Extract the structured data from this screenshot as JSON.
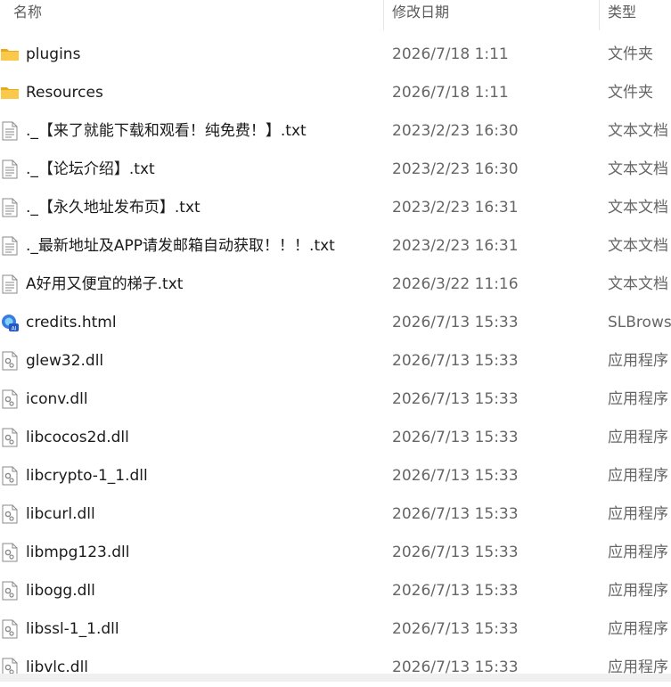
{
  "header": {
    "name": "名称",
    "date": "修改日期",
    "type": "类型"
  },
  "files": [
    {
      "icon": "folder-icon",
      "name": "plugins",
      "date": "2026/7/18 1:11",
      "type": "文件夹"
    },
    {
      "icon": "folder-icon",
      "name": "Resources",
      "date": "2026/7/18 1:11",
      "type": "文件夹"
    },
    {
      "icon": "text-file-icon",
      "name": "._【来了就能下载和观看！纯免费！】.txt",
      "date": "2023/2/23 16:30",
      "type": "文本文档"
    },
    {
      "icon": "text-file-icon",
      "name": "._【论坛介绍】.txt",
      "date": "2023/2/23 16:30",
      "type": "文本文档"
    },
    {
      "icon": "text-file-icon",
      "name": "._【永久地址发布页】.txt",
      "date": "2023/2/23 16:31",
      "type": "文本文档"
    },
    {
      "icon": "text-file-icon",
      "name": "._最新地址及APP请发邮箱自动获取！！！.txt",
      "date": "2023/2/23 16:31",
      "type": "文本文档"
    },
    {
      "icon": "text-file-icon",
      "name": "A好用又便宜的梯子.txt",
      "date": "2026/3/22 11:16",
      "type": "文本文档"
    },
    {
      "icon": "browser-html-icon",
      "name": "credits.html",
      "date": "2026/7/13 15:33",
      "type": "SLBrows"
    },
    {
      "icon": "dll-file-icon",
      "name": "glew32.dll",
      "date": "2026/7/13 15:33",
      "type": "应用程序"
    },
    {
      "icon": "dll-file-icon",
      "name": "iconv.dll",
      "date": "2026/7/13 15:33",
      "type": "应用程序"
    },
    {
      "icon": "dll-file-icon",
      "name": "libcocos2d.dll",
      "date": "2026/7/13 15:33",
      "type": "应用程序"
    },
    {
      "icon": "dll-file-icon",
      "name": "libcrypto-1_1.dll",
      "date": "2026/7/13 15:33",
      "type": "应用程序"
    },
    {
      "icon": "dll-file-icon",
      "name": "libcurl.dll",
      "date": "2026/7/13 15:33",
      "type": "应用程序"
    },
    {
      "icon": "dll-file-icon",
      "name": "libmpg123.dll",
      "date": "2026/7/13 15:33",
      "type": "应用程序"
    },
    {
      "icon": "dll-file-icon",
      "name": "libogg.dll",
      "date": "2026/7/13 15:33",
      "type": "应用程序"
    },
    {
      "icon": "dll-file-icon",
      "name": "libssl-1_1.dll",
      "date": "2026/7/13 15:33",
      "type": "应用程序"
    },
    {
      "icon": "dll-file-icon",
      "name": "libvlc.dll",
      "date": "2026/7/13 15:33",
      "type": "应用程序"
    }
  ]
}
